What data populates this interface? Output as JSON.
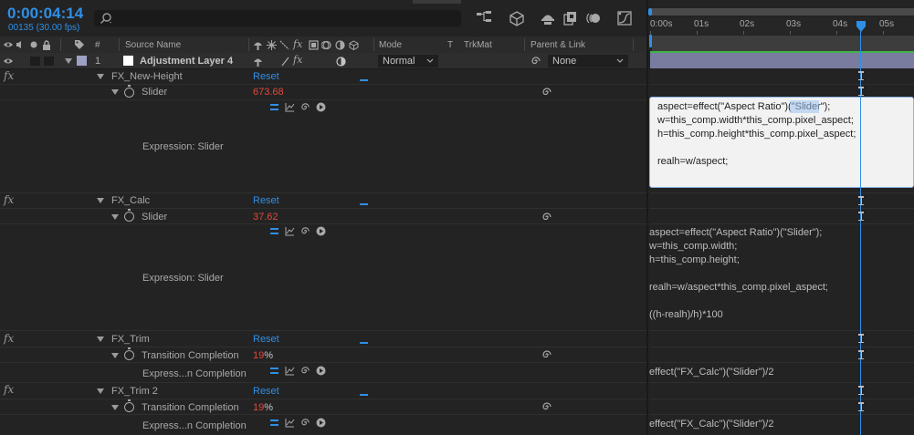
{
  "timecode": "0:00:04:14",
  "frame_info": "00135 (30.00 fps)",
  "search": {
    "placeholder": ""
  },
  "columns": {
    "num": "#",
    "source_name": "Source Name",
    "mode": "Mode",
    "t": "T",
    "trkmat": "TrkMat",
    "parent": "Parent & Link"
  },
  "ruler": [
    "0:00s",
    "01s",
    "02s",
    "03s",
    "04s",
    "05s"
  ],
  "layer": {
    "index": "1",
    "name": "Adjustment Layer 4",
    "mode": "Normal",
    "parent": "None"
  },
  "fx_symbol": "fx",
  "effects": [
    {
      "name": "FX_New-Height",
      "reset": "Reset",
      "prop_name": "Slider",
      "value": "673.68",
      "unit": "",
      "expr_label": "Expression: Slider",
      "code": "aspect=effect(\"Aspect Ratio\")(\"Slider\");\nw=this_comp.width*this_comp.pixel_aspect;\nh=this_comp.height*this_comp.pixel_aspect;\n\nrealh=w/aspect;"
    },
    {
      "name": "FX_Calc",
      "reset": "Reset",
      "prop_name": "Slider",
      "value": "37.62",
      "unit": "",
      "expr_label": "Expression: Slider",
      "code": "aspect=effect(\"Aspect Ratio\")(\"Slider\");\nw=this_comp.width;\nh=this_comp.height;\n\nrealh=w/aspect*this_comp.pixel_aspect;\n\n((h-realh)/h)*100"
    },
    {
      "name": "FX_Trim",
      "reset": "Reset",
      "prop_name": "Transition Completion",
      "value": "19",
      "unit": "%",
      "expr_label": "Express...n Completion",
      "code": "effect(\"FX_Calc\")(\"Slider\")/2"
    },
    {
      "name": "FX_Trim 2",
      "reset": "Reset",
      "prop_name": "Transition Completion",
      "value": "19",
      "unit": "%",
      "expr_label": "Express...n Completion",
      "code": "effect(\"FX_Calc\")(\"Slider\")/2"
    }
  ],
  "colors": {
    "accent": "#2f8fe6",
    "value_red": "#e04a3a",
    "layer_bar": "#797b9f",
    "green_line": "#3fb34a"
  }
}
